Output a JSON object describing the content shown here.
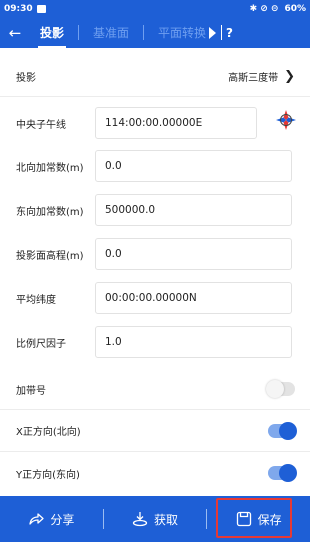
{
  "status": {
    "time": "09:30",
    "icons": "✱ ⊘ ⊝",
    "battery": "60%"
  },
  "colors": {
    "primary": "#1e5fd6",
    "highlight": "#e53935"
  },
  "appbar": {
    "back_icon": "arrow-left-icon",
    "tabs": [
      {
        "label": "投影",
        "active": true
      },
      {
        "label": "基准面",
        "active": false
      },
      {
        "label": "平面转换",
        "active": false
      }
    ],
    "help": "?"
  },
  "form": {
    "projection": {
      "label": "投影",
      "value": "高斯三度带"
    },
    "central_meridian": {
      "label": "中央子午线",
      "value": "114:00:00.00000E"
    },
    "north_offset": {
      "label": "北向加常数(m)",
      "value": "0.0"
    },
    "east_offset": {
      "label": "东向加常数(m)",
      "value": "500000.0"
    },
    "proj_height": {
      "label": "投影面高程(m)",
      "value": "0.0"
    },
    "avg_latitude": {
      "label": "平均纬度",
      "value": "00:00:00.00000N"
    },
    "scale_factor": {
      "label": "比例尺因子",
      "value": "1.0"
    },
    "add_zone": {
      "label": "加带号",
      "on": false
    },
    "x_north": {
      "label": "X正方向(北向)",
      "on": true
    },
    "y_east": {
      "label": "Y正方向(东向)",
      "on": true
    }
  },
  "bottom": {
    "share": "分享",
    "fetch": "获取",
    "save": "保存"
  }
}
